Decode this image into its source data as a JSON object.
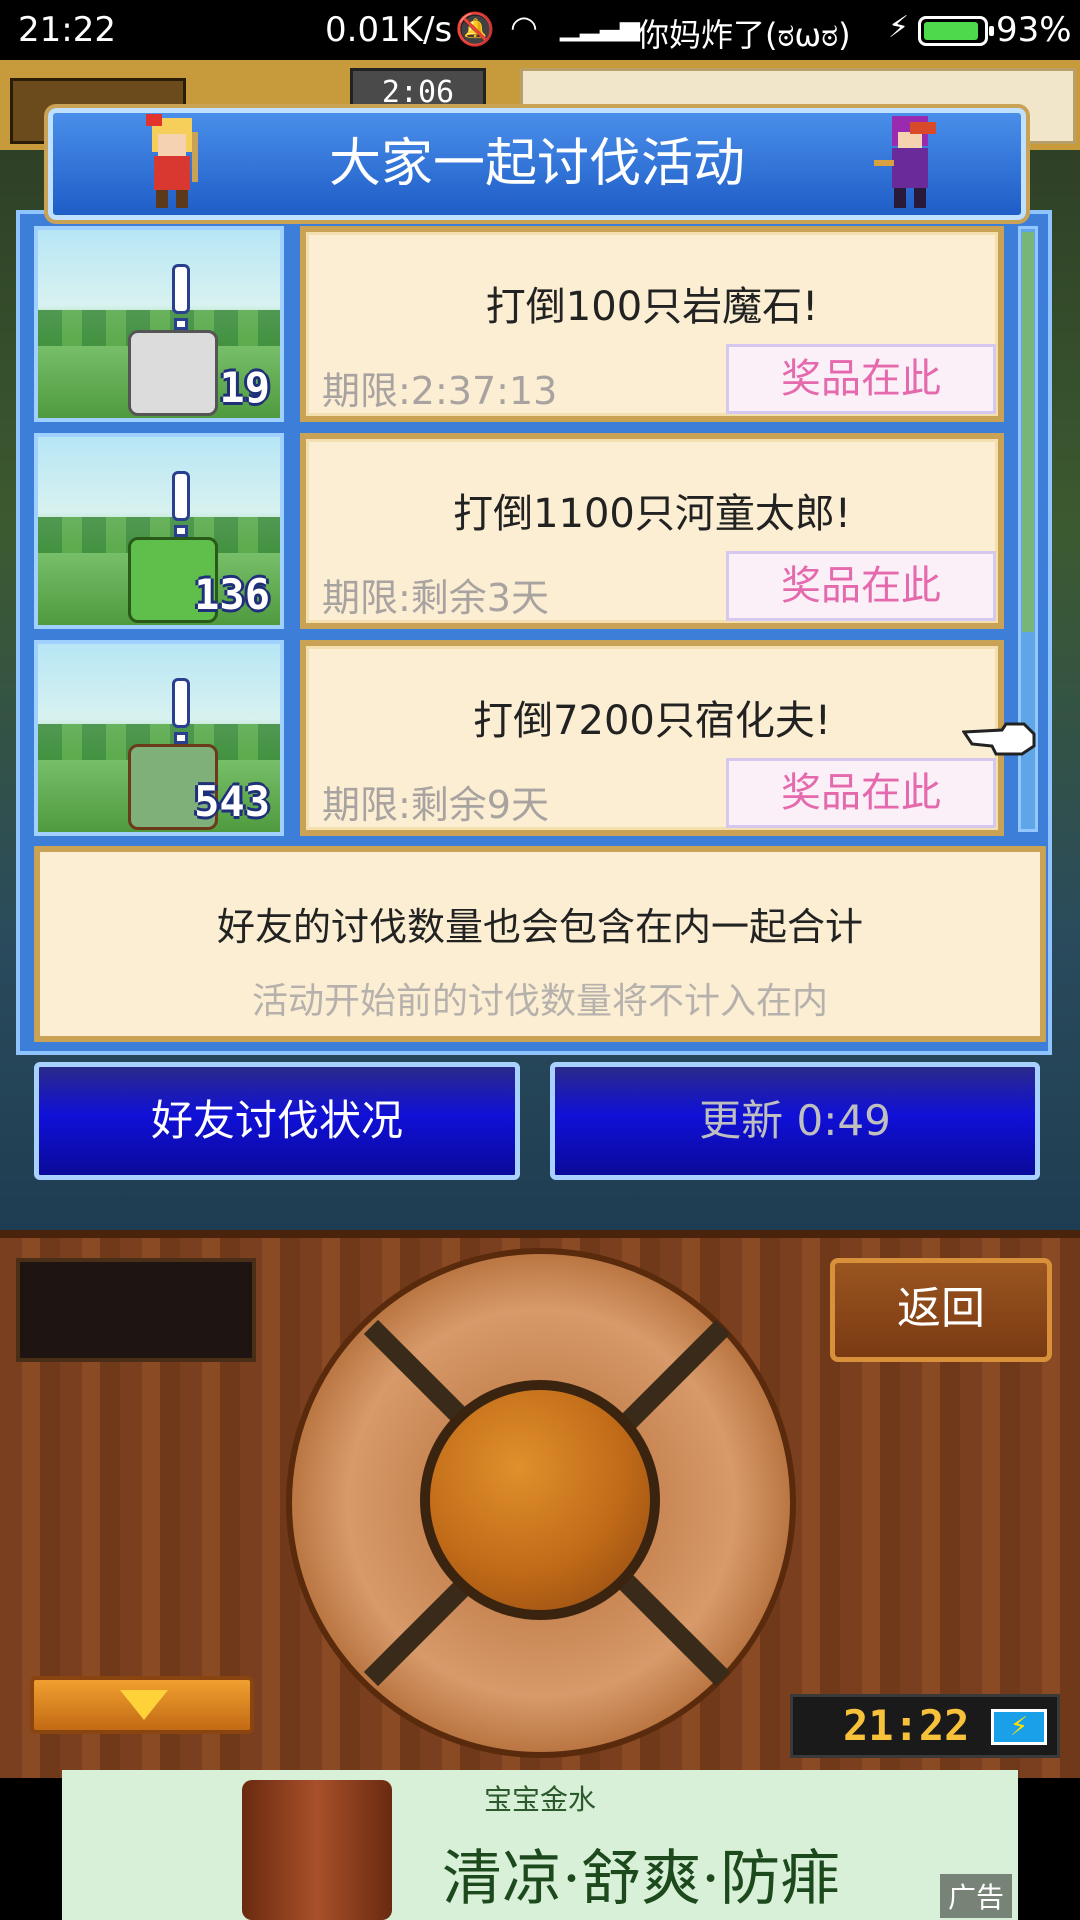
{
  "status_bar": {
    "time": "21:22",
    "network_speed": "0.01K/s",
    "carrier": "你妈炸了(ಠωಠ)",
    "battery_percent": "93%"
  },
  "hud": {
    "clock": "2:06"
  },
  "dialog": {
    "title": "大家一起讨伐活动",
    "quests": [
      {
        "count": "19",
        "title": "打倒100只岩魔石!",
        "deadline": "期限:2:37:13",
        "prize_label": "奖品在此",
        "monster_color": "#dcdcdc"
      },
      {
        "count": "136",
        "title": "打倒1100只河童太郎!",
        "deadline": "期限:剩余3天",
        "prize_label": "奖品在此",
        "monster_color": "#5fbf4a"
      },
      {
        "count": "543",
        "title": "打倒7200只宿化夫!",
        "deadline": "期限:剩余9天",
        "prize_label": "奖品在此",
        "monster_color": "#7fb07a"
      }
    ],
    "info_line1": "好友的讨伐数量也会包含在内一起合计",
    "info_line2": "活动开始前的讨伐数量将不计入在内",
    "friend_status_button": "好友讨伐状况",
    "refresh_button": "更新 0:49"
  },
  "controls": {
    "back_button": "返回",
    "game_time": "21:22"
  },
  "ad": {
    "small_text": "宝宝金水",
    "big_text": "清凉·舒爽·防痱",
    "label": "广告"
  },
  "colors": {
    "panel_blue": "#3c7ed8",
    "card_bg": "#fbeed2",
    "prize_text": "#e469ad",
    "button_blue": "#1010d8"
  }
}
